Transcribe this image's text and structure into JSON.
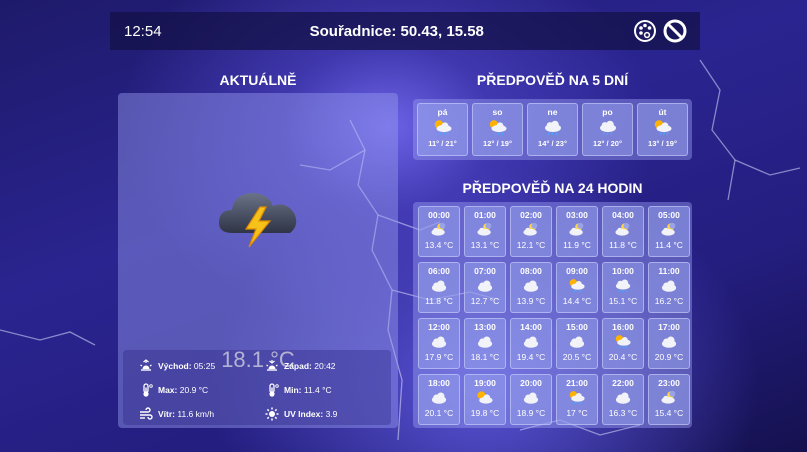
{
  "header": {
    "time": "12:54",
    "coordinates": "Souřadnice: 50.43, 15.58",
    "icons": [
      "palette-icon",
      "block-icon"
    ]
  },
  "current": {
    "title": "AKTUÁLNĚ",
    "icon": "thunderstorm-icon",
    "temperature": "18.1 °C",
    "details": [
      {
        "icon": "sunrise-icon",
        "label": "Východ:",
        "value": "05:25"
      },
      {
        "icon": "sunset-icon",
        "label": "Západ:",
        "value": "20:42"
      },
      {
        "icon": "thermometer-icon",
        "label": "Max:",
        "value": "20.9 °C"
      },
      {
        "icon": "thermometer-icon",
        "label": "Min:",
        "value": "11.4 °C"
      },
      {
        "icon": "wind-icon",
        "label": "Vítr:",
        "value": "11.6 km/h"
      },
      {
        "icon": "sun-icon",
        "label": "UV Index:",
        "value": "3.9"
      }
    ]
  },
  "forecast5": {
    "title": "PŘEDPOVĚĎ NA 5 DNÍ",
    "days": [
      {
        "name": "pá",
        "range": "11° / 21°",
        "icon": "sun-cloud-rain-icon"
      },
      {
        "name": "so",
        "range": "12° / 19°",
        "icon": "sun-cloud-rain-icon"
      },
      {
        "name": "ne",
        "range": "14° / 23°",
        "icon": "cloud-rain-icon"
      },
      {
        "name": "po",
        "range": "12° / 20°",
        "icon": "cloud-rain-icon"
      },
      {
        "name": "út",
        "range": "13° / 19°",
        "icon": "sun-cloud-rain-icon"
      }
    ]
  },
  "forecast24": {
    "title": "PŘEDPOVĚĎ NA 24 HODIN",
    "hours": [
      {
        "hour": "00:00",
        "temp": "13.4 °C",
        "icon": "moon-cloud-icon"
      },
      {
        "hour": "01:00",
        "temp": "13.1 °C",
        "icon": "moon-cloud-icon"
      },
      {
        "hour": "02:00",
        "temp": "12.1 °C",
        "icon": "moon-cloud-icon"
      },
      {
        "hour": "03:00",
        "temp": "11.9 °C",
        "icon": "moon-cloud-icon"
      },
      {
        "hour": "04:00",
        "temp": "11.8 °C",
        "icon": "moon-cloud-icon"
      },
      {
        "hour": "05:00",
        "temp": "11.4 °C",
        "icon": "moon-cloud-icon"
      },
      {
        "hour": "06:00",
        "temp": "11.8 °C",
        "icon": "cloud-icon"
      },
      {
        "hour": "07:00",
        "temp": "12.7 °C",
        "icon": "cloud-icon"
      },
      {
        "hour": "08:00",
        "temp": "13.9 °C",
        "icon": "cloud-icon"
      },
      {
        "hour": "09:00",
        "temp": "14.4 °C",
        "icon": "sun-cloud-rain-icon"
      },
      {
        "hour": "10:00",
        "temp": "15.1 °C",
        "icon": "cloud-rain-icon"
      },
      {
        "hour": "11:00",
        "temp": "16.2 °C",
        "icon": "cloud-icon"
      },
      {
        "hour": "12:00",
        "temp": "17.9 °C",
        "icon": "cloud-icon"
      },
      {
        "hour": "13:00",
        "temp": "18.1 °C",
        "icon": "cloud-icon"
      },
      {
        "hour": "14:00",
        "temp": "19.4 °C",
        "icon": "cloud-icon"
      },
      {
        "hour": "15:00",
        "temp": "20.5 °C",
        "icon": "cloud-icon"
      },
      {
        "hour": "16:00",
        "temp": "20.4 °C",
        "icon": "sun-cloud-rain-icon"
      },
      {
        "hour": "17:00",
        "temp": "20.9 °C",
        "icon": "cloud-icon"
      },
      {
        "hour": "18:00",
        "temp": "20.1 °C",
        "icon": "cloud-icon"
      },
      {
        "hour": "19:00",
        "temp": "19.8 °C",
        "icon": "sun-cloud-icon"
      },
      {
        "hour": "20:00",
        "temp": "18.9 °C",
        "icon": "cloud-icon"
      },
      {
        "hour": "21:00",
        "temp": "17 °C",
        "icon": "sun-cloud-rain-icon"
      },
      {
        "hour": "22:00",
        "temp": "16.3 °C",
        "icon": "cloud-icon"
      },
      {
        "hour": "23:00",
        "temp": "15.4 °C",
        "icon": "moon-cloud-icon"
      }
    ]
  }
}
